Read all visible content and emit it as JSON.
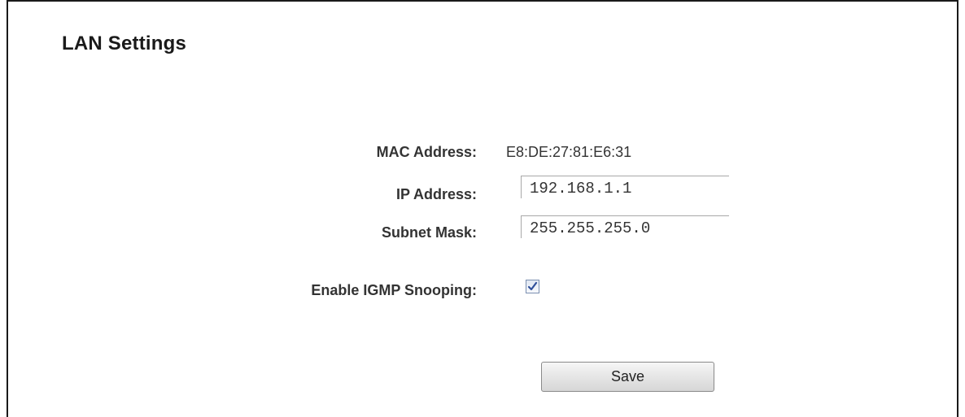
{
  "page": {
    "title": "LAN Settings"
  },
  "fields": {
    "mac": {
      "label": "MAC Address:",
      "value": "E8:DE:27:81:E6:31"
    },
    "ip": {
      "label": "IP Address:",
      "value": "192.168.1.1"
    },
    "subnet": {
      "label": "Subnet Mask:",
      "value": "255.255.255.0"
    },
    "igmp": {
      "label": "Enable IGMP Snooping:",
      "checked": true
    }
  },
  "actions": {
    "save_label": "Save"
  },
  "colors": {
    "frame_border": "#1a1a1a",
    "text": "#333333",
    "input_border": "#a8a8a8",
    "checkbox_check": "#2f4f9a"
  },
  "icons": {
    "checkbox": "checkmark-icon"
  }
}
